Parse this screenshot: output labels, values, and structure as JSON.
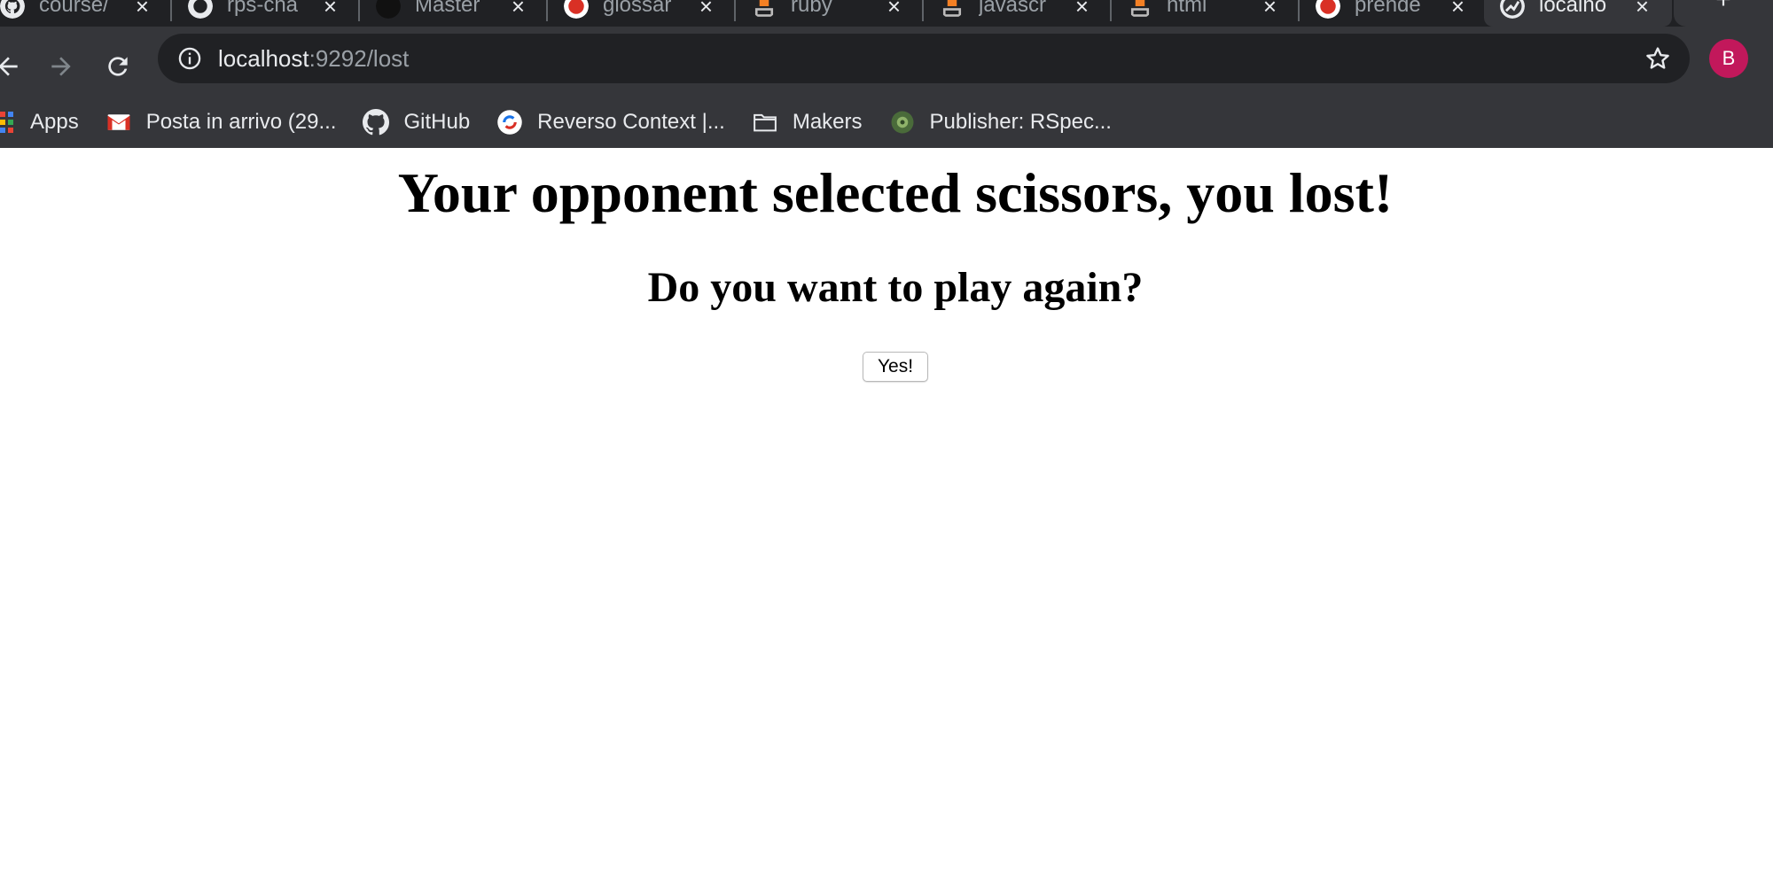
{
  "browser": {
    "tabs": [
      {
        "title": "course/",
        "icon": "github-icon",
        "active": false
      },
      {
        "title": "rps-cha",
        "icon": "github-icon",
        "active": false
      },
      {
        "title": "Master",
        "icon": "makers-icon",
        "active": false
      },
      {
        "title": "glossar",
        "icon": "reverso-icon",
        "active": false
      },
      {
        "title": "ruby",
        "icon": "stackoverflow-icon",
        "active": false
      },
      {
        "title": "javascr",
        "icon": "stackoverflow-icon",
        "active": false
      },
      {
        "title": "html",
        "icon": "stackoverflow-icon",
        "active": false
      },
      {
        "title": "prende",
        "icon": "reverso-icon",
        "active": false
      },
      {
        "title": "localho",
        "icon": "globe-icon",
        "active": true
      }
    ],
    "new_tab_label": "+",
    "address_bar": {
      "host": "localhost",
      "rest": ":9292/lost"
    },
    "profile_initial": "B",
    "bookmarks": [
      {
        "label": "Apps",
        "icon": "apps-grid-icon"
      },
      {
        "label": "Posta in arrivo (29...",
        "icon": "gmail-icon"
      },
      {
        "label": "GitHub",
        "icon": "github-icon"
      },
      {
        "label": "Reverso Context |...",
        "icon": "reverso-icon"
      },
      {
        "label": "Makers",
        "icon": "folder-icon"
      },
      {
        "label": "Publisher: RSpec...",
        "icon": "publisher-icon"
      }
    ]
  },
  "page": {
    "heading": "Your opponent selected scissors, you lost!",
    "subheading": "Do you want to play again?",
    "play_again_button": "Yes!"
  },
  "colors": {
    "chrome_dark": "#202124",
    "chrome_toolbar": "#35363a",
    "avatar": "#c2185b"
  }
}
